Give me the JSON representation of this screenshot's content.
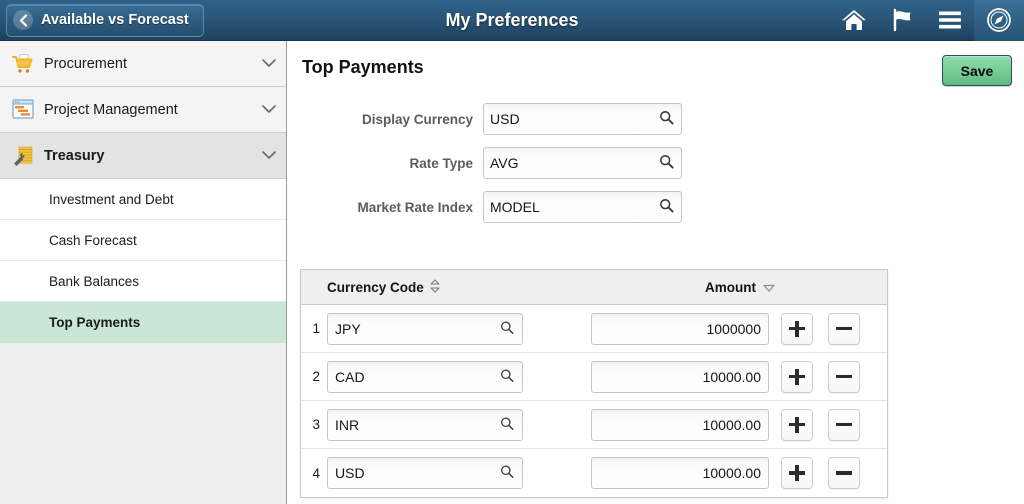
{
  "header": {
    "back_label": "Available vs Forecast",
    "back_icon": "chevron-left-icon",
    "title": "My Preferences",
    "icons": [
      {
        "name": "home-icon",
        "label": "Home"
      },
      {
        "name": "flag-icon",
        "label": "Notifications"
      },
      {
        "name": "hamburger-menu-icon",
        "label": "Actions Menu"
      },
      {
        "name": "navigator-compass-icon",
        "label": "NavBar"
      }
    ]
  },
  "sidebar": {
    "groups": [
      {
        "label": "Procurement",
        "icon": "shopping-cart-icon",
        "expanded": false,
        "chevron": "chevron-down-icon"
      },
      {
        "label": "Project Management",
        "icon": "gantt-window-icon",
        "expanded": false,
        "chevron": "chevron-down-icon"
      },
      {
        "label": "Treasury",
        "icon": "treasury-stack-icon",
        "expanded": true,
        "chevron": "chevron-down-icon"
      }
    ],
    "subitems": [
      {
        "label": "Investment and Debt",
        "active": false
      },
      {
        "label": "Cash Forecast",
        "active": false
      },
      {
        "label": "Bank Balances",
        "active": false
      },
      {
        "label": "Top Payments",
        "active": true
      }
    ],
    "active_color": "#c9e7d4"
  },
  "main": {
    "page_title": "Top Payments",
    "save_label": "Save",
    "save_color": "#7bcf99",
    "fields": [
      {
        "label": "Display Currency",
        "value": "USD",
        "placeholder": "",
        "lookup_icon": "magnifier-icon"
      },
      {
        "label": "Rate Type",
        "value": "AVG",
        "placeholder": "",
        "lookup_icon": "magnifier-icon"
      },
      {
        "label": "Market Rate Index",
        "value": "MODEL",
        "placeholder": "",
        "lookup_icon": "magnifier-icon"
      }
    ],
    "grid": {
      "columns": [
        {
          "label": "Currency Code",
          "sort_icon": "sort-updown-icon"
        },
        {
          "label": "Amount",
          "sort_icon": "sort-descending-icon"
        }
      ],
      "rows": [
        {
          "num": "1",
          "currency": "JPY",
          "amount": "1000000"
        },
        {
          "num": "2",
          "currency": "CAD",
          "amount": "10000.00"
        },
        {
          "num": "3",
          "currency": "INR",
          "amount": "10000.00"
        },
        {
          "num": "4",
          "currency": "USD",
          "amount": "10000.00"
        }
      ],
      "add_label": "+",
      "remove_label": "−"
    }
  }
}
